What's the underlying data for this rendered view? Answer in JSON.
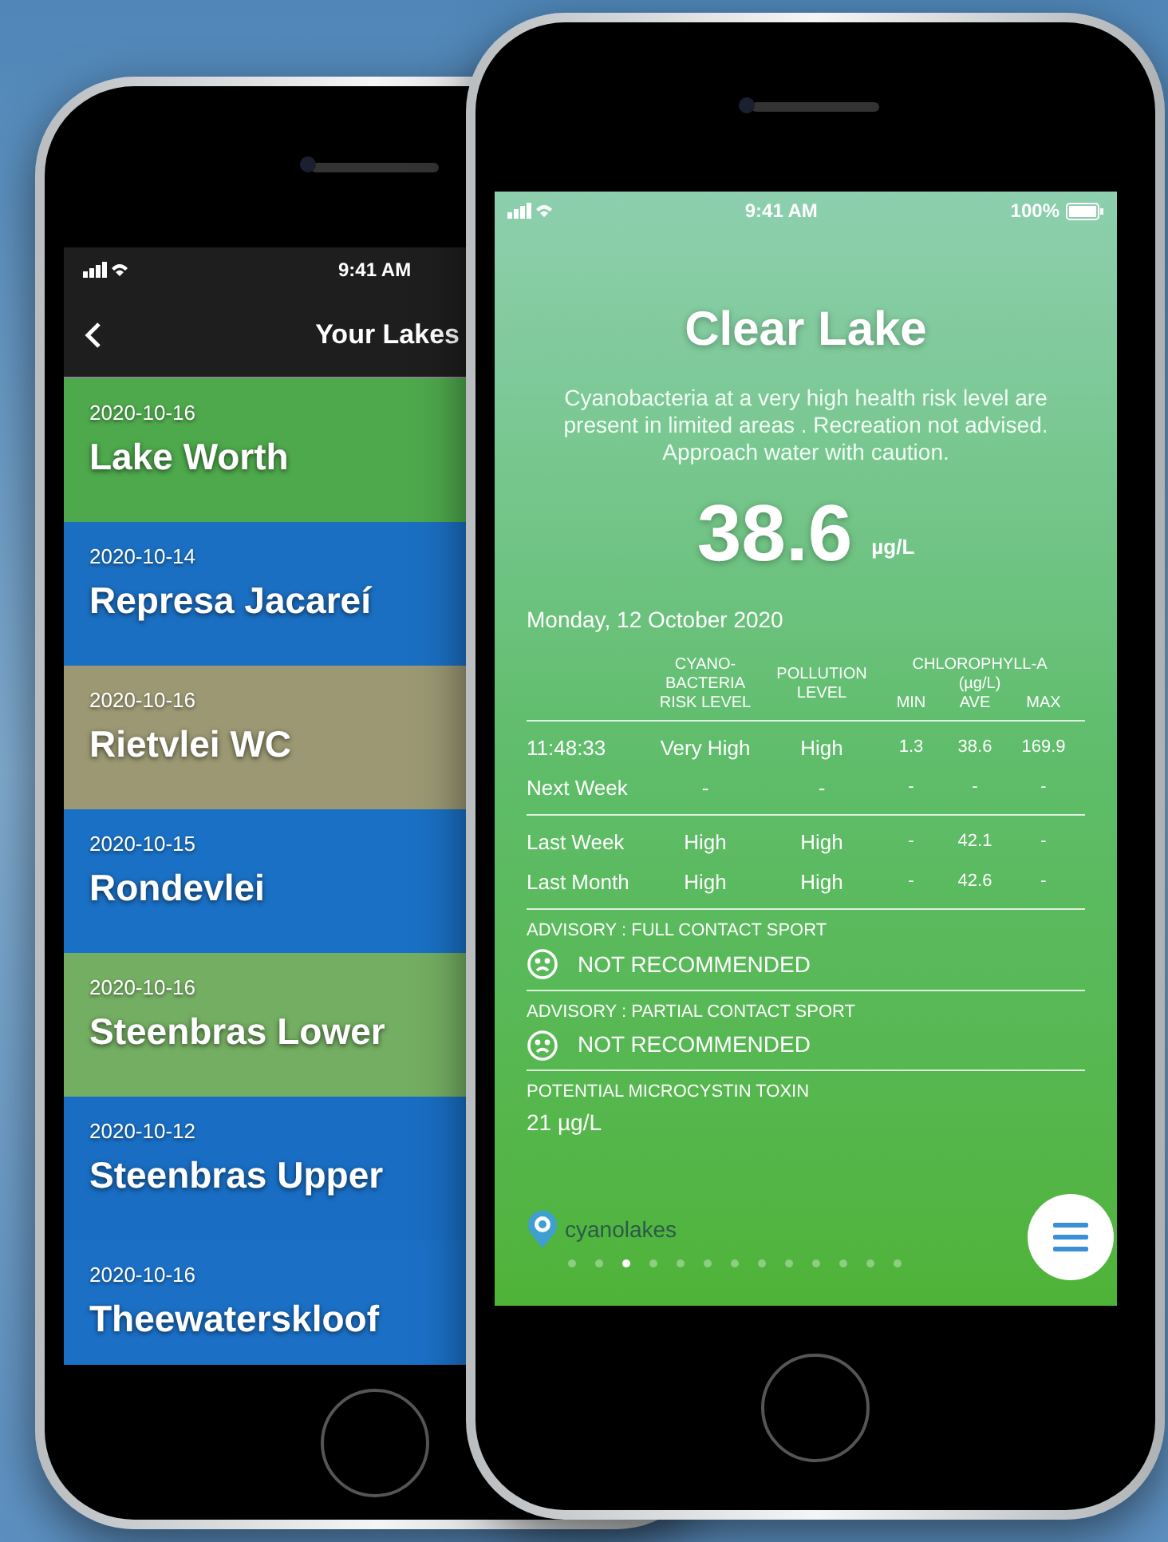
{
  "list_phone": {
    "status_bar": {
      "time": "9:41 AM"
    },
    "header": {
      "title": "Your Lakes"
    },
    "lakes": [
      {
        "date": "2020-10-16",
        "name": "Lake Worth",
        "color": "#4ea84c"
      },
      {
        "date": "2020-10-14",
        "name": "Represa Jacareí",
        "color": "#1b6fc2"
      },
      {
        "date": "2020-10-16",
        "name": "Rietvlei WC",
        "color": "#9b9873"
      },
      {
        "date": "2020-10-15",
        "name": "Rondevlei",
        "color": "#1a70c4"
      },
      {
        "date": "2020-10-16",
        "name": "Steenbras Lower",
        "color": "#74ae62"
      },
      {
        "date": "2020-10-12",
        "name": "Steenbras Upper",
        "color": "#196ec3"
      },
      {
        "date": "2020-10-16",
        "name": "Theewaterskloof",
        "color": "#1b70c6"
      }
    ]
  },
  "detail_phone": {
    "status_bar": {
      "time": "9:41 AM",
      "battery": "100%"
    },
    "title": "Clear Lake",
    "description": "Cyanobacteria at a very high health risk level are present in limited areas . Recreation not advised. Approach water with caution.",
    "value": "38.6",
    "unit": "µg/L",
    "date": "Monday, 12 October 2020",
    "table": {
      "columns": [
        "CYANO-BACTERIA RISK LEVEL",
        "POLLUTION LEVEL"
      ],
      "group_header": "CHLOROPHYLL-A (µg/L)",
      "sub_columns": [
        "MIN",
        "AVE",
        "MAX"
      ],
      "row_groups": [
        [
          [
            "11:48:33",
            "Very High",
            "High",
            "1.3",
            "38.6",
            "169.9"
          ],
          [
            "Next Week",
            "-",
            "-",
            "-",
            "-",
            "-"
          ]
        ],
        [
          [
            "Last Week",
            "High",
            "High",
            "-",
            "42.1",
            "-"
          ],
          [
            "Last Month",
            "High",
            "High",
            "-",
            "42.6",
            "-"
          ]
        ]
      ]
    },
    "advisories": [
      {
        "label": "ADVISORY : FULL CONTACT SPORT",
        "verdict": "NOT RECOMMENDED"
      },
      {
        "label": "ADVISORY : PARTIAL CONTACT SPORT",
        "verdict": "NOT RECOMMENDED"
      }
    ],
    "toxin": {
      "label": "POTENTIAL MICROCYSTIN TOXIN",
      "value": "21 µg/L"
    },
    "logo": "cyanolakes",
    "page_dots": [
      {
        "selected": false
      },
      {
        "selected": false
      },
      {
        "selected": true
      },
      {
        "selected": false
      },
      {
        "selected": false
      },
      {
        "selected": false
      },
      {
        "selected": false
      },
      {
        "selected": false
      },
      {
        "selected": false
      },
      {
        "selected": false
      },
      {
        "selected": false
      },
      {
        "selected": false
      },
      {
        "selected": false
      }
    ]
  }
}
